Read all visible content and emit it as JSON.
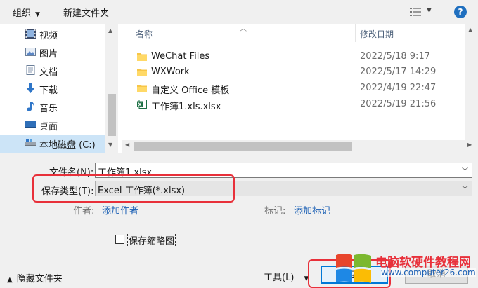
{
  "toolbar": {
    "organize_label": "组织",
    "new_folder_label": "新建文件夹",
    "help_label": "?"
  },
  "nav": {
    "items": [
      {
        "label": "视频",
        "icon": "video-icon"
      },
      {
        "label": "图片",
        "icon": "pictures-icon"
      },
      {
        "label": "文档",
        "icon": "documents-icon"
      },
      {
        "label": "下载",
        "icon": "download-icon"
      },
      {
        "label": "音乐",
        "icon": "music-icon"
      },
      {
        "label": "桌面",
        "icon": "desktop-icon"
      },
      {
        "label": "本地磁盘 (C:)",
        "icon": "drive-icon"
      }
    ],
    "selected_index": 6
  },
  "filelist": {
    "columns": {
      "name": "名称",
      "date": "修改日期"
    },
    "rows": [
      {
        "name": "WeChat Files",
        "date": "2022/5/18 9:17",
        "type": "folder"
      },
      {
        "name": "WXWork",
        "date": "2022/5/17 14:29",
        "type": "folder"
      },
      {
        "name": "自定义 Office 模板",
        "date": "2022/4/19 22:47",
        "type": "folder"
      },
      {
        "name": "工作簿1.xls.xlsx",
        "date": "2022/5/19 21:56",
        "type": "excel"
      }
    ]
  },
  "form": {
    "filename_label": "文件名(N):",
    "filename_value": "工作簿1.xlsx",
    "savetype_label": "保存类型(T):",
    "savetype_value": "Excel 工作簿(*.xlsx)",
    "author_label": "作者:",
    "author_link": "添加作者",
    "tags_label": "标记:",
    "tags_link": "添加标记",
    "thumbnail_label": "保存缩略图",
    "hide_folders_label": "隐藏文件夹",
    "tools_label": "工具(L)",
    "save_button": "保存(S)",
    "cancel_button": "取消"
  },
  "watermark": {
    "title": "电脑软硬件教程网",
    "url": "www.computer26.com"
  },
  "colors": {
    "highlight_box": "#e8303a",
    "selection": "#cce4f7",
    "link": "#1a5fb4",
    "accent": "#0078d7"
  }
}
